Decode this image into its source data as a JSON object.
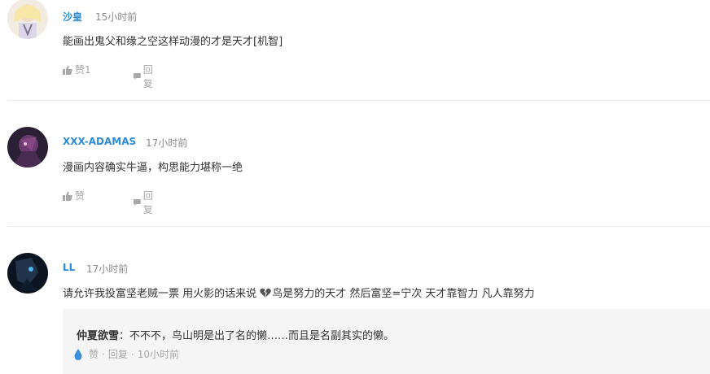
{
  "comments": [
    {
      "username": "沙皇",
      "time": "15小时前",
      "text": "能画出鬼父和缘之空这样动漫的才是天才[机智]",
      "like_label": "赞1",
      "reply_label": "回复"
    },
    {
      "username": "XXX-ADAMAS",
      "time": "17小时前",
      "text": "漫画内容确实牛逼，构思能力堪称一绝",
      "like_label": "赞",
      "reply_label": "回复"
    },
    {
      "username": "LL",
      "time": "17小时前",
      "text_before_icon": "请允许我投富坚老贼一票 用火影的话来说 ",
      "text_after_icon": "鸟是努力的天才 然后富坚=宁次 天才靠智力 凡人靠努力"
    }
  ],
  "sub_reply": {
    "author": "仲夏欲雪",
    "separator": "：",
    "text": "不不不，鸟山明是出了名的懒……而且是名副其实的懒。",
    "like_label": "赞",
    "dot1": "·",
    "reply_label": "回复",
    "dot2": "·",
    "time": "10小时前"
  },
  "colors": {
    "username": "#2e8bd6",
    "meta": "#a8a8a8",
    "sub_bg": "#f5f5f5"
  },
  "icons": [
    "thumbs-up-icon",
    "speech-bubble-icon",
    "water-drop-icon",
    "broken-heart-icon"
  ]
}
